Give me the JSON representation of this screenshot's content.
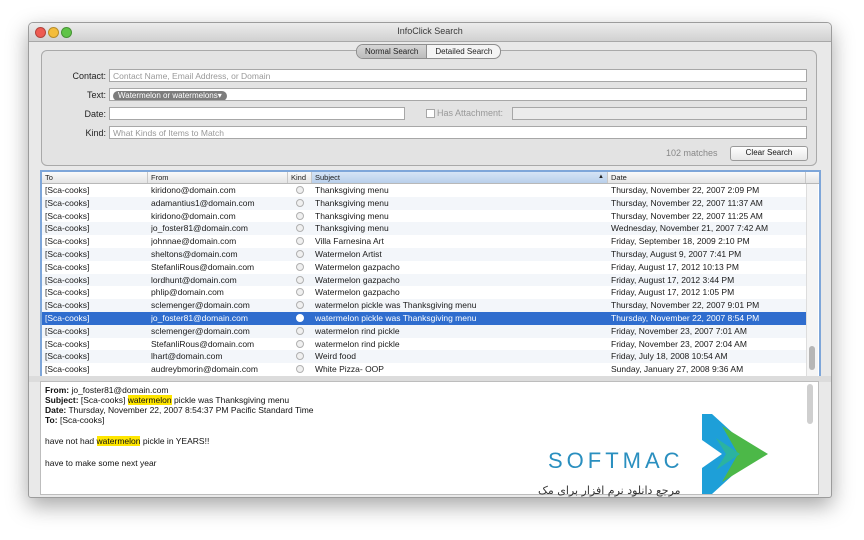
{
  "window": {
    "title": "InfoClick Search"
  },
  "mode_tabs": [
    "Normal Search",
    "Detailed Search"
  ],
  "criteria": {
    "contact_label": "Contact:",
    "contact_placeholder": "Contact Name, Email Address, or Domain",
    "text_label": "Text:",
    "text_token": "Watermelon or watermelons▾",
    "date_label": "Date:",
    "has_attachment_label": "Has Attachment:",
    "kind_label": "Kind:",
    "kind_placeholder": "What Kinds of Items to Match",
    "matches": "102 matches",
    "clear_button": "Clear Search"
  },
  "table": {
    "columns": [
      "To",
      "From",
      "Kind",
      "Subject",
      "Date"
    ],
    "sort_indicator": "▲",
    "rows": [
      {
        "to": "[Sca-cooks]",
        "from": "kiridono@domain.com",
        "subject": "Thanksgiving menu",
        "date": "Thursday, November 22, 2007 2:09 PM"
      },
      {
        "to": "[Sca-cooks]",
        "from": "adamantius1@domain.com",
        "subject": "Thanksgiving menu",
        "date": "Thursday, November 22, 2007 11:37 AM"
      },
      {
        "to": "[Sca-cooks]",
        "from": "kiridono@domain.com",
        "subject": "Thanksgiving menu",
        "date": "Thursday, November 22, 2007 11:25 AM"
      },
      {
        "to": "[Sca-cooks]",
        "from": "jo_foster81@domain.com",
        "subject": "Thanksgiving menu",
        "date": "Wednesday, November 21, 2007 7:42 AM"
      },
      {
        "to": "[Sca-cooks]",
        "from": "johnnae@domain.com",
        "subject": "Villa Farnesina Art",
        "date": "Friday, September 18, 2009 2:10 PM"
      },
      {
        "to": "[Sca-cooks]",
        "from": "sheltons@domain.com",
        "subject": "Watermelon Artist",
        "date": "Thursday, August 9, 2007 7:41 PM"
      },
      {
        "to": "[Sca-cooks]",
        "from": "StefanliRous@domain.com",
        "subject": "Watermelon gazpacho",
        "date": "Friday, August 17, 2012 10:13 PM"
      },
      {
        "to": "[Sca-cooks]",
        "from": "lordhunt@domain.com",
        "subject": "Watermelon gazpacho",
        "date": "Friday, August 17, 2012 3:44 PM"
      },
      {
        "to": "[Sca-cooks]",
        "from": "phlip@domain.com",
        "subject": "Watermelon gazpacho",
        "date": "Friday, August 17, 2012 1:05 PM"
      },
      {
        "to": "[Sca-cooks]",
        "from": "sclemenger@domain.com",
        "subject": "watermelon pickle was Thanksgiving menu",
        "date": "Thursday, November 22, 2007 9:01 PM"
      },
      {
        "to": "[Sca-cooks]",
        "from": "jo_foster81@domain.com",
        "subject": "watermelon pickle was Thanksgiving menu",
        "date": "Thursday, November 22, 2007 8:54 PM"
      },
      {
        "to": "[Sca-cooks]",
        "from": "sclemenger@domain.com",
        "subject": "watermelon rind pickle",
        "date": "Friday, November 23, 2007 7:01 AM"
      },
      {
        "to": "[Sca-cooks]",
        "from": "StefanliRous@domain.com",
        "subject": "watermelon rind pickle",
        "date": "Friday, November 23, 2007 2:04 AM"
      },
      {
        "to": "[Sca-cooks]",
        "from": "lhart@domain.com",
        "subject": "Weird food",
        "date": "Friday, July 18, 2008 10:54 AM"
      },
      {
        "to": "[Sca-cooks]",
        "from": "audreybmorin@domain.com",
        "subject": "White Pizza- OOP",
        "date": "Sunday, January 27, 2008 9:36 AM"
      }
    ]
  },
  "preview": {
    "from_label": "From:",
    "from_value": "jo_foster81@domain.com",
    "subject_label": "Subject:",
    "subject_pre": "[Sca-cooks]",
    "subject_hl": "watermelon",
    "subject_post": "pickle was Thanksgiving menu",
    "date_label": "Date:",
    "date_value": "Thursday, November 22, 2007 8:54:37 PM Pacific Standard Time",
    "to_label": "To:",
    "to_value": "[Sca-cooks]",
    "body1_pre": "have not had",
    "body1_hl": "watermelon",
    "body1_post": "pickle in YEARS!!",
    "body2": "have to make some next year"
  },
  "watermark": {
    "brand": "SOFTMAC",
    "tagline": "مرجع دانلود نرم افزار برای مک"
  },
  "colors": {
    "selection": "#2f6dce",
    "highlight": "#ffe600",
    "brand": "#2a8fbf"
  }
}
